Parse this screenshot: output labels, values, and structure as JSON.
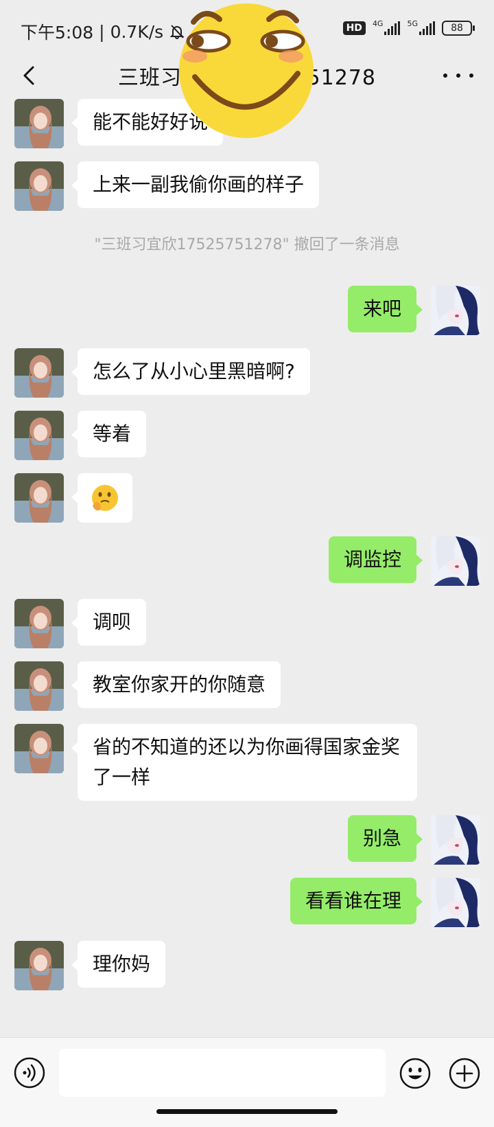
{
  "status_bar": {
    "time": "下午5:08",
    "speed": "0.7K/s",
    "hd": "HD",
    "net1": "4G",
    "net2": "5G",
    "battery": "88"
  },
  "header": {
    "title": "三班习宜欣17525751278"
  },
  "messages": [
    {
      "side": "left",
      "text": "能不能好好说"
    },
    {
      "side": "left",
      "text": "上来一副我偷你画的样子"
    },
    {
      "side": "system",
      "text": "\"三班习宜欣17525751278\" 撤回了一条消息"
    },
    {
      "side": "right",
      "text": "来吧"
    },
    {
      "side": "left",
      "text": "怎么了从小心里黑暗啊?"
    },
    {
      "side": "left",
      "text": "等着"
    },
    {
      "side": "left",
      "text": "🫣",
      "emoji": "thinking-face-emoji"
    },
    {
      "side": "right",
      "text": "调监控"
    },
    {
      "side": "left",
      "text": "调呗"
    },
    {
      "side": "left",
      "text": "教室你家开的你随意"
    },
    {
      "side": "left",
      "text": "省的不知道的还以为你画得国家金奖了一样"
    },
    {
      "side": "right",
      "text": "别急"
    },
    {
      "side": "right",
      "text": "看看谁在理"
    },
    {
      "side": "left",
      "text": "理你妈"
    }
  ],
  "input": {
    "value": "",
    "placeholder": ""
  },
  "colors": {
    "background": "#ededed",
    "sent_bubble": "#95ec69",
    "received_bubble": "#ffffff",
    "system_text": "#a8a8a8"
  },
  "icons": {
    "back": "chevron-left-icon",
    "more": "more-dots-icon",
    "voice": "voice-icon",
    "emoji": "emoji-smile-icon",
    "plus": "plus-circle-icon",
    "overlay": "smirk-face-emoji"
  }
}
